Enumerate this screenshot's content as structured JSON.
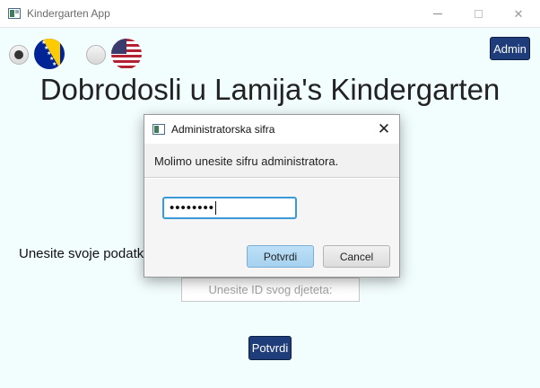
{
  "window": {
    "title": "Kindergarten App",
    "minimize_icon": "minimize-icon",
    "maximize_icon": "maximize-icon",
    "close_symbol": "✕"
  },
  "languages": {
    "options": [
      {
        "name": "bosnian",
        "flag_icon": "bosnia-flag-icon",
        "selected": true
      },
      {
        "name": "english",
        "flag_icon": "usa-flag-icon",
        "selected": false
      }
    ]
  },
  "admin_button": {
    "label": "Admin"
  },
  "main": {
    "welcome": "Dobrodosli u Lamija's Kindergarten",
    "data_prompt": "Unesite svoje podatk",
    "id_placeholder": "Unesite ID svog djeteta:",
    "confirm_label": "Potvrdi"
  },
  "dialog": {
    "title": "Administratorska sifra",
    "close_symbol": "✕",
    "header_text": "Molimo unesite sifru administratora.",
    "password_mask": "••••••••",
    "ok_label": "Potvrdi",
    "cancel_label": "Cancel"
  },
  "colors": {
    "background": "#f2fdfd",
    "primary_button": "#1f3d7a",
    "focus_border": "#3b9ad6"
  }
}
